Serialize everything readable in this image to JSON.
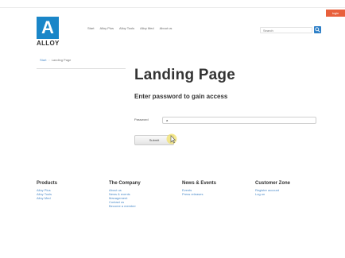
{
  "header": {
    "corner_badge": "login",
    "logo_letter": "A",
    "logo_word": "ALLOY",
    "nav": [
      "Start",
      "Alloy Plus",
      "Alloy Tools",
      "Alloy Med",
      "About us"
    ],
    "search_placeholder": "Search"
  },
  "breadcrumb": {
    "home": "Start",
    "separator": "::",
    "current": "Landing Page"
  },
  "main": {
    "title": "Landing Page",
    "subtitle": "Enter password to gain access",
    "password_label": "Password",
    "password_value": "a",
    "submit_label": "Submit"
  },
  "footer": {
    "columns": [
      {
        "heading": "Products",
        "links": [
          "Alloy Plus",
          "Alloy Tools",
          "Alloy Med"
        ]
      },
      {
        "heading": "The Company",
        "links": [
          "About us",
          "News & events",
          "Management",
          "Contact us",
          "Become a member"
        ]
      },
      {
        "heading": "News & Events",
        "links": [
          "Events",
          "Press releases"
        ]
      },
      {
        "heading": "Customer Zone",
        "links": [
          "Register account",
          "Log on"
        ]
      }
    ]
  },
  "colors": {
    "brand_blue": "#1a86c8",
    "link_blue": "#4a8ac9",
    "badge_orange": "#e8603c",
    "cursor_highlight": "#f2e16b"
  }
}
